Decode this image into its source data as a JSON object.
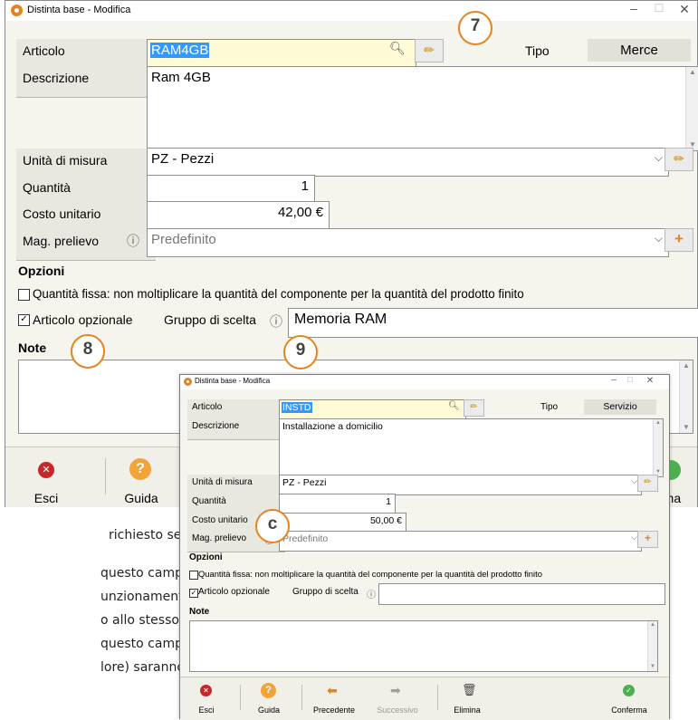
{
  "back": {
    "title": "Distinta base - Modifica",
    "labels": {
      "articolo": "Articolo",
      "descrizione": "Descrizione",
      "unita": "Unità di misura",
      "quantita": "Quantità",
      "costo": "Costo unitario",
      "mag": "Mag. prelievo",
      "tipo": "Tipo",
      "opzioni": "Opzioni",
      "gruppo": "Gruppo di scelta",
      "note": "Note"
    },
    "values": {
      "articolo": "RAM4GB",
      "tipo": "Merce",
      "descrizione": "Ram 4GB",
      "unita": "PZ - Pezzi",
      "quantita": "1",
      "costo": "42,00 €",
      "mag": "Predefinito",
      "gruppo": "Memoria RAM"
    },
    "options": {
      "fissa": "Quantità fissa: non moltiplicare la quantità del componente per la quantità del prodotto finito",
      "opzionale": "Articolo opzionale"
    },
    "toolbar": {
      "esci": "Esci",
      "guida": "Guida",
      "conferma": "rma"
    }
  },
  "front": {
    "title": "Distinta base - Modifica",
    "labels": {
      "articolo": "Articolo",
      "descrizione": "Descrizione",
      "unita": "Unità di misura",
      "quantita": "Quantità",
      "costo": "Costo unitario",
      "mag": "Mag. prelievo",
      "tipo": "Tipo",
      "opzioni": "Opzioni",
      "gruppo": "Gruppo di scelta",
      "note": "Note"
    },
    "values": {
      "articolo": "INSTD",
      "tipo": "Servizio",
      "descrizione": "Installazione a domicilio",
      "unita": "PZ - Pezzi",
      "quantita": "1",
      "costo": "50,00 €",
      "mag": "Predefinito",
      "gruppo": ""
    },
    "options": {
      "fissa": "Quantità fissa: non moltiplicare la quantità del componente per la quantità del prodotto finito",
      "opzionale": "Articolo opzionale"
    },
    "toolbar": {
      "esci": "Esci",
      "guida": "Guida",
      "precedente": "Precedente",
      "successivo": "Successivo",
      "elimina": "Elimina",
      "conferma": "Conferma"
    }
  },
  "badges": {
    "b7": "7",
    "b8": "8",
    "b9": "9",
    "bc": "c"
  },
  "document_text": {
    "line1": "richiesto se",
    "line2": "questo campo",
    "line3": "unzionamento:",
    "line4": "o allo stesso",
    "line5": "questo campo",
    "line6": "lore) saranno"
  },
  "colors": {
    "accent": "#e8821e",
    "selection": "#3399ff",
    "window_bg": "#f5f4ed"
  }
}
